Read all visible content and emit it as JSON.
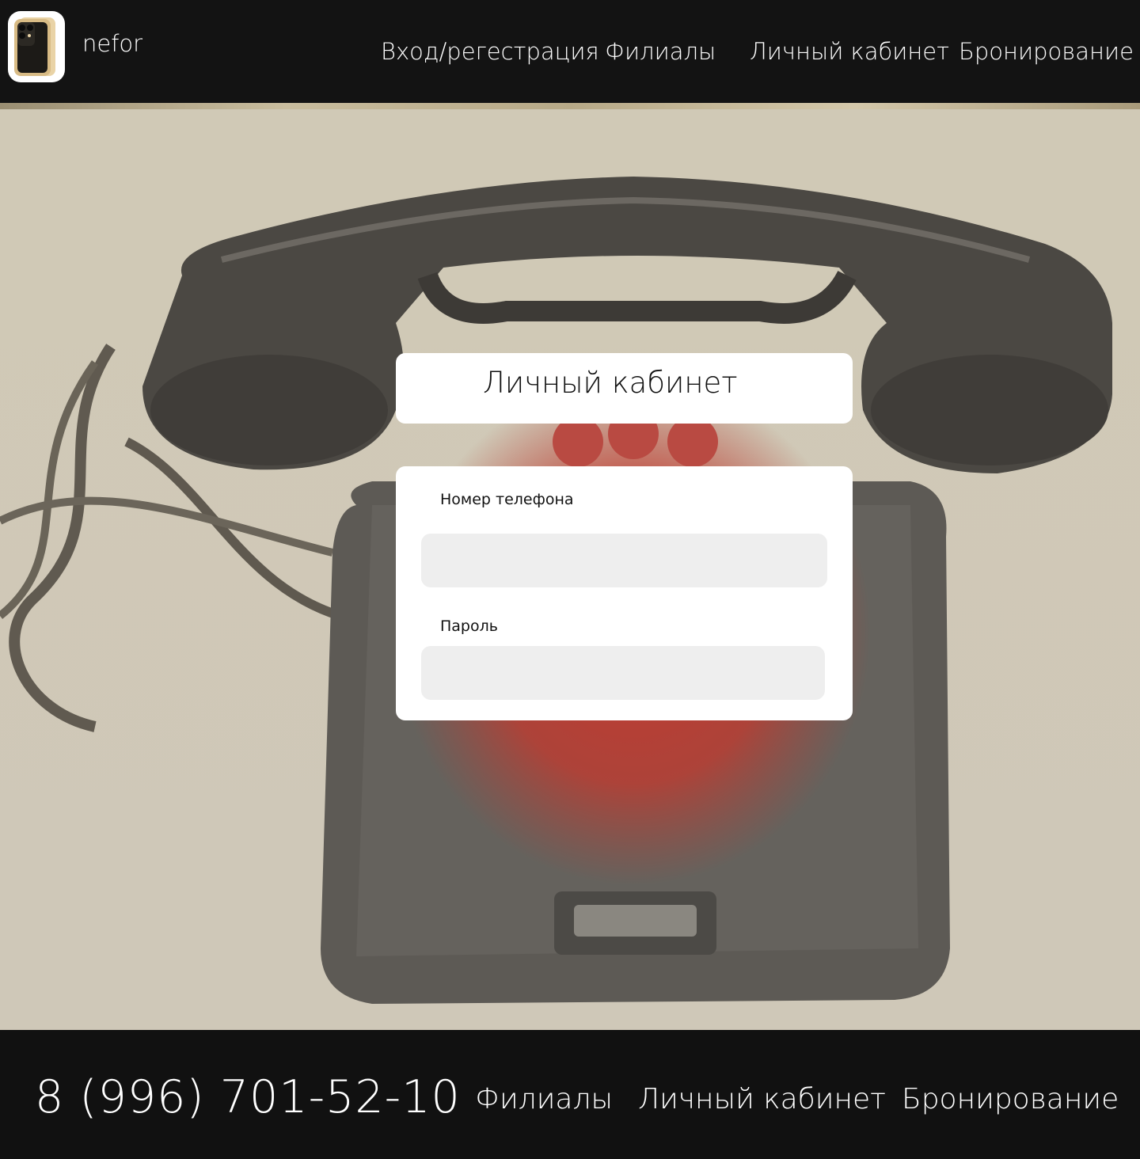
{
  "header": {
    "brand": "nefor",
    "nav": {
      "login": "Вход/регестрация",
      "branches": "Филиалы",
      "account": "Личный кабинет",
      "booking": "Бронирование"
    }
  },
  "login_card": {
    "title": "Личный кабинет",
    "phone_label": "Номер телефона",
    "phone_value": "",
    "password_label": "Пароль",
    "password_value": ""
  },
  "footer": {
    "phone": "8 (996) 701-52-10",
    "nav": {
      "branches": "Филиалы",
      "account": "Личный кабинет",
      "booking": "Бронирование"
    }
  },
  "colors": {
    "header_bg": "#131313",
    "footer_bg": "#111111",
    "card_bg": "#ffffff",
    "input_bg": "#eeeeee",
    "dial_accent": "#c8382e"
  },
  "icons": {
    "logo": "smartphone-logo-icon"
  }
}
